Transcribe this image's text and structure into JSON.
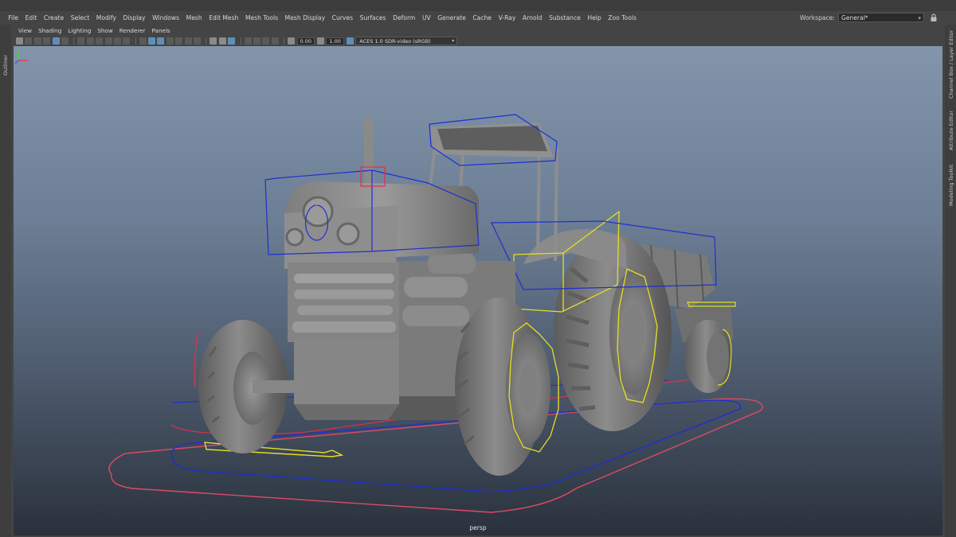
{
  "menubar": {
    "items": [
      "File",
      "Edit",
      "Create",
      "Select",
      "Modify",
      "Display",
      "Windows",
      "Mesh",
      "Edit Mesh",
      "Mesh Tools",
      "Mesh Display",
      "Curves",
      "Surfaces",
      "Deform",
      "UV",
      "Generate",
      "Cache",
      "V-Ray",
      "Arnold",
      "Substance",
      "Help",
      "Zoo Tools"
    ],
    "workspace_label": "Workspace:",
    "workspace_value": "General*"
  },
  "panel_menu": [
    "View",
    "Shading",
    "Lighting",
    "Show",
    "Renderer",
    "Panels"
  ],
  "toolbar": {
    "field1": "0.00",
    "field2": "1.00",
    "color_management": "ACES 1.0 SDR-video (sRGB)"
  },
  "side_tabs": {
    "left": [
      "Outliner"
    ],
    "right": [
      "Channel Box / Layer Editor",
      "Attribute Editor",
      "Modeling Toolkit"
    ]
  },
  "viewport": {
    "camera": "persp",
    "bg_top": "#8395ab",
    "bg_bottom": "#2a313c"
  },
  "colors": {
    "selection_blue": "#1e2fd0",
    "rig_yellow": "#e4e020",
    "curve_red": "#e0304a",
    "mesh_gray": "#8a8a8a"
  }
}
